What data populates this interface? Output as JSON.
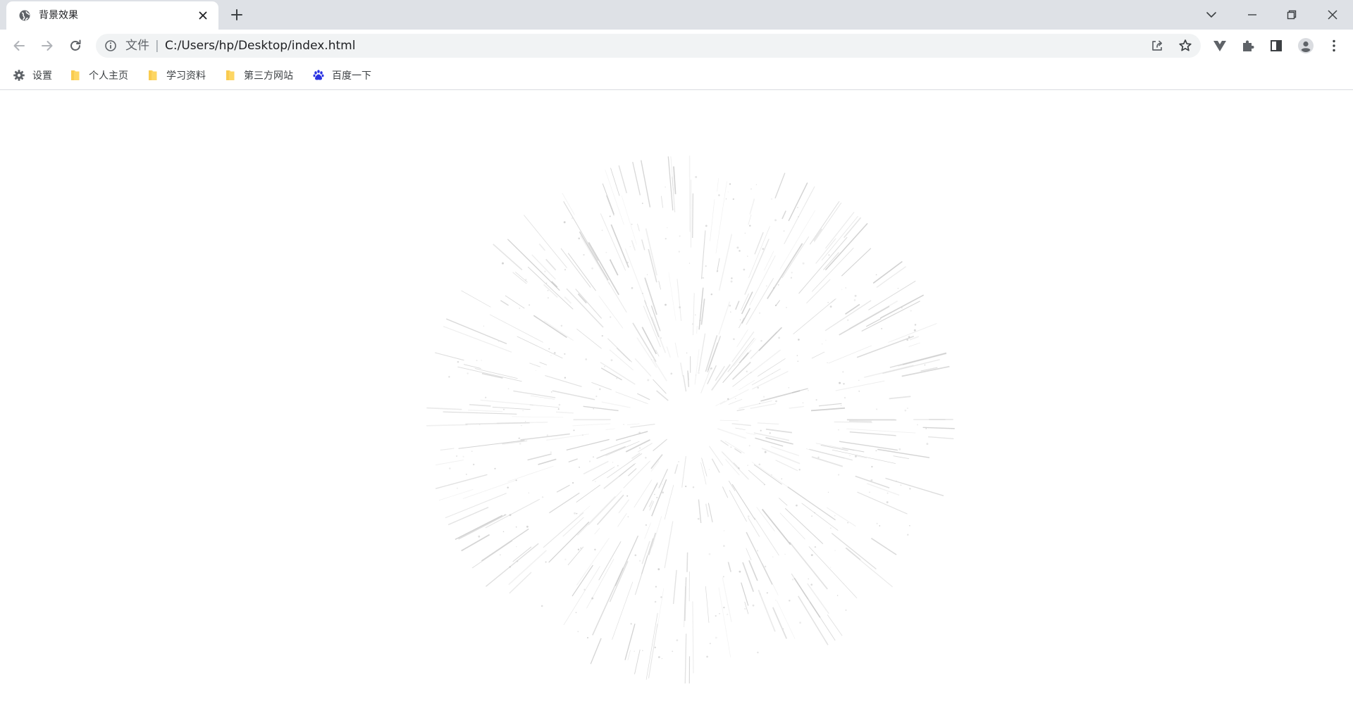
{
  "tab": {
    "title": "背景效果",
    "favicon": "globe-icon"
  },
  "window_controls": [
    "tab-search-icon",
    "minimize-icon",
    "restore-icon",
    "close-icon"
  ],
  "toolbar": {
    "omnibox": {
      "scheme_label": "文件",
      "separator": "|",
      "url": "C:/Users/hp/Desktop/index.html"
    }
  },
  "bookmarks": [
    {
      "label": "设置",
      "icon": "gear-icon"
    },
    {
      "label": "个人主页",
      "icon": "folder-icon"
    },
    {
      "label": "学习资料",
      "icon": "folder-icon"
    },
    {
      "label": "第三方网站",
      "icon": "folder-icon"
    },
    {
      "label": "百度一下",
      "icon": "baidu-paw-icon"
    }
  ],
  "colors": {
    "tabstrip": "#dee1e6",
    "omnibox": "#f1f3f4",
    "folder": "#fdd663",
    "folder_tab": "#f6c343",
    "baidu": "#2932e1",
    "streak": "#bdbdbd"
  }
}
